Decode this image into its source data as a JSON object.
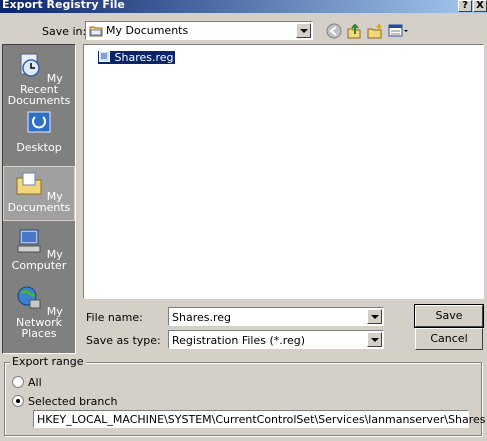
{
  "window": {
    "title": "Export Registry File",
    "help_label": "?",
    "close_label": "X"
  },
  "save_in": {
    "label": "Save in:",
    "value": "My Documents"
  },
  "places": [
    {
      "label": "My Recent Documents"
    },
    {
      "label": "Desktop"
    },
    {
      "label": "My Documents"
    },
    {
      "label": "My Computer"
    },
    {
      "label": "My Network Places"
    }
  ],
  "files": [
    {
      "name": "Shares.reg"
    }
  ],
  "file_name": {
    "label": "File name:",
    "value": "Shares.reg"
  },
  "save_as_type": {
    "label": "Save as type:",
    "value": "Registration Files (*.reg)"
  },
  "buttons": {
    "save": "Save",
    "cancel": "Cancel"
  },
  "export_range": {
    "label": "Export range",
    "all_label": "All",
    "selected_label": "Selected branch",
    "selected": "Selected branch",
    "branch_value": "HKEY_LOCAL_MACHINE\\SYSTEM\\CurrentControlSet\\Services\\lanmanserver\\Shares"
  },
  "colors": {
    "titlebar_start": "#0a246a",
    "titlebar_end": "#a6caf0",
    "selection": "#0a246a",
    "face": "#d4d0c8"
  }
}
